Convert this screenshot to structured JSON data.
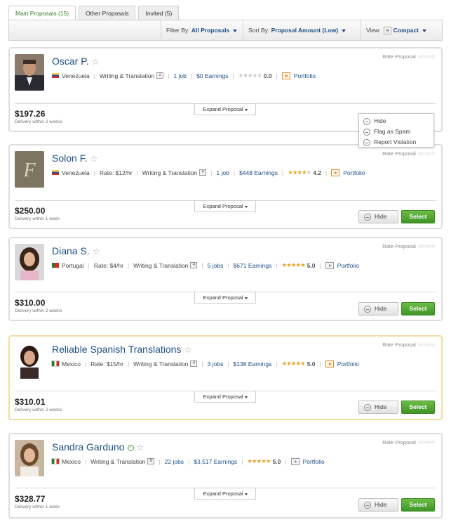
{
  "tabs": [
    {
      "label": "Main Proposals (15)",
      "active": true
    },
    {
      "label": "Other Proposals",
      "active": false
    },
    {
      "label": "Invited (5)",
      "active": false
    }
  ],
  "toolbar": {
    "filter_label": "Filter By:",
    "filter_value": "All Proposals",
    "sort_label": "Sort By:",
    "sort_value": "Proposal Amount (Low)",
    "view_label": "View:",
    "view_value": "Compact"
  },
  "common": {
    "rate_label": "Rate Proposal",
    "rate_dots": "○○○○○",
    "expand_label": "Expand Proposal",
    "hide_label": "Hide",
    "select_label": "Select",
    "portfolio_label": "Portfolio",
    "rating_scale": 5
  },
  "menu": {
    "items": [
      "Hide",
      "Flag as Spam",
      "Report Violation"
    ]
  },
  "proposals": [
    {
      "name": "Oscar P.",
      "country": "Venezuela",
      "rate": "",
      "category": "Writing & Translation",
      "category_count": "2",
      "jobs": "1 job",
      "earnings": "$0 Earnings",
      "rating": "0.0",
      "amount": "$197.26",
      "delivery": "Delivery within 2 weeks",
      "verified": false,
      "highlight": false,
      "flag_colors": [
        "#f4d33e",
        "#1e4fa5",
        "#d52b1e"
      ],
      "portfolio_color": "orange"
    },
    {
      "name": "Solon F.",
      "country": "Venezuela",
      "rate": "Rate: $12/hr",
      "category": "Writing & Translation",
      "category_count": "4",
      "jobs": "1 job",
      "earnings": "$448 Earnings",
      "rating": "4.2",
      "amount": "$250.00",
      "delivery": "Delivery within 1 week",
      "verified": false,
      "highlight": false,
      "flag_colors": [
        "#f4d33e",
        "#1e4fa5",
        "#d52b1e"
      ],
      "portfolio_color": "orange"
    },
    {
      "name": "Diana S.",
      "country": "Portugal",
      "rate": "Rate: $4/hr",
      "category": "Writing & Translation",
      "category_count": "4",
      "jobs": "5 jobs",
      "earnings": "$671 Earnings",
      "rating": "5.0",
      "amount": "$310.00",
      "delivery": "Delivery within 2 weeks",
      "verified": false,
      "highlight": false,
      "flag_colors": [
        "#1f7a2e",
        "#d52b1e"
      ],
      "portfolio_color": "grey"
    },
    {
      "name": "Reliable Spanish Translations",
      "country": "Mexico",
      "rate": "Rate: $15/hr",
      "category": "Writing & Translation",
      "category_count": "4",
      "jobs": "3 jobs",
      "earnings": "$138 Earnings",
      "rating": "5.0",
      "amount": "$310.01",
      "delivery": "Delivery within 2 weeks",
      "verified": false,
      "highlight": true,
      "flag_colors": [
        "#1f7a2e",
        "#ffffff",
        "#d52b1e"
      ],
      "portfolio_color": "orange"
    },
    {
      "name": "Sandra Garduno",
      "country": "Mexico",
      "rate": "",
      "category": "Writing & Translation",
      "category_count": "8",
      "jobs": "22 jobs",
      "earnings": "$3,517 Earnings",
      "rating": "5.0",
      "amount": "$328.77",
      "delivery": "Delivery within 1 week",
      "verified": true,
      "highlight": false,
      "flag_colors": [
        "#1f7a2e",
        "#ffffff",
        "#d52b1e"
      ],
      "portfolio_color": "grey"
    }
  ]
}
